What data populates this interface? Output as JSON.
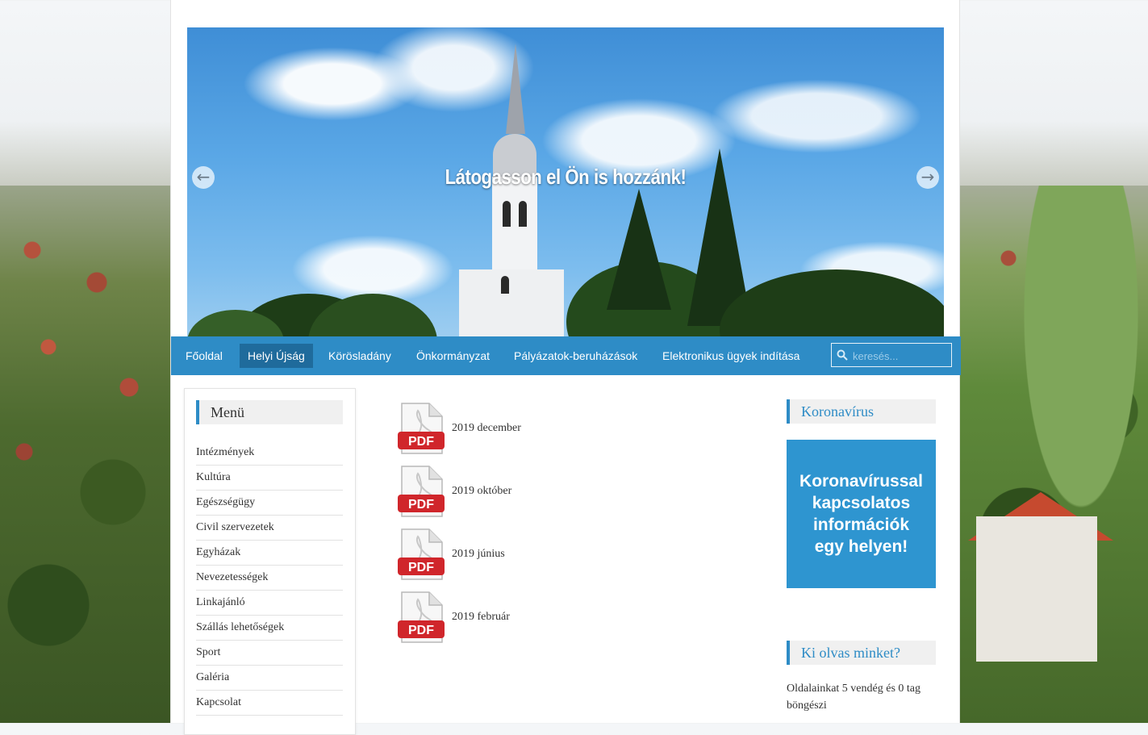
{
  "hero": {
    "caption": "Látogasson el Ön is hozzánk!",
    "prev_icon": "arrow-left-icon",
    "next_icon": "arrow-right-icon"
  },
  "nav": {
    "items": [
      {
        "label": "Főoldal",
        "active": false
      },
      {
        "label": "Helyi Újság",
        "active": true
      },
      {
        "label": "Körösladány",
        "active": false
      },
      {
        "label": "Önkormányzat",
        "active": false
      },
      {
        "label": "Pályázatok-beruházások",
        "active": false
      },
      {
        "label": "Elektronikus ügyek indítása",
        "active": false
      }
    ],
    "search_placeholder": "keresés...",
    "search_icon": "search-icon"
  },
  "menu": {
    "title": "Menü",
    "items": [
      "Intézmények",
      "Kultúra",
      "Egészségügy",
      "Civil szervezetek",
      "Egyházak",
      "Nevezetességek",
      "Linkajánló",
      "Szállás lehetőségek",
      "Sport",
      "Galéria",
      "Kapcsolat"
    ]
  },
  "documents": [
    {
      "label": "2019 december",
      "icon_text": "PDF"
    },
    {
      "label": "2019 október",
      "icon_text": "PDF"
    },
    {
      "label": "2019 június",
      "icon_text": "PDF"
    },
    {
      "label": "2019 február",
      "icon_text": "PDF"
    }
  ],
  "sidebar": {
    "covid_title": "Koronavírus",
    "covid_banner": [
      "Koronavírussal",
      "kapcsolatos",
      "információk",
      "egy helyen!"
    ],
    "readers_title": "Ki olvas minket?",
    "readers_text": "Oldalainkat 5 vendég és 0 tag böngészi"
  },
  "colors": {
    "accent": "#2e8cc6",
    "nav_active": "#1f6b9c",
    "banner": "#2e95d0",
    "pdf_red": "#d0262b"
  }
}
